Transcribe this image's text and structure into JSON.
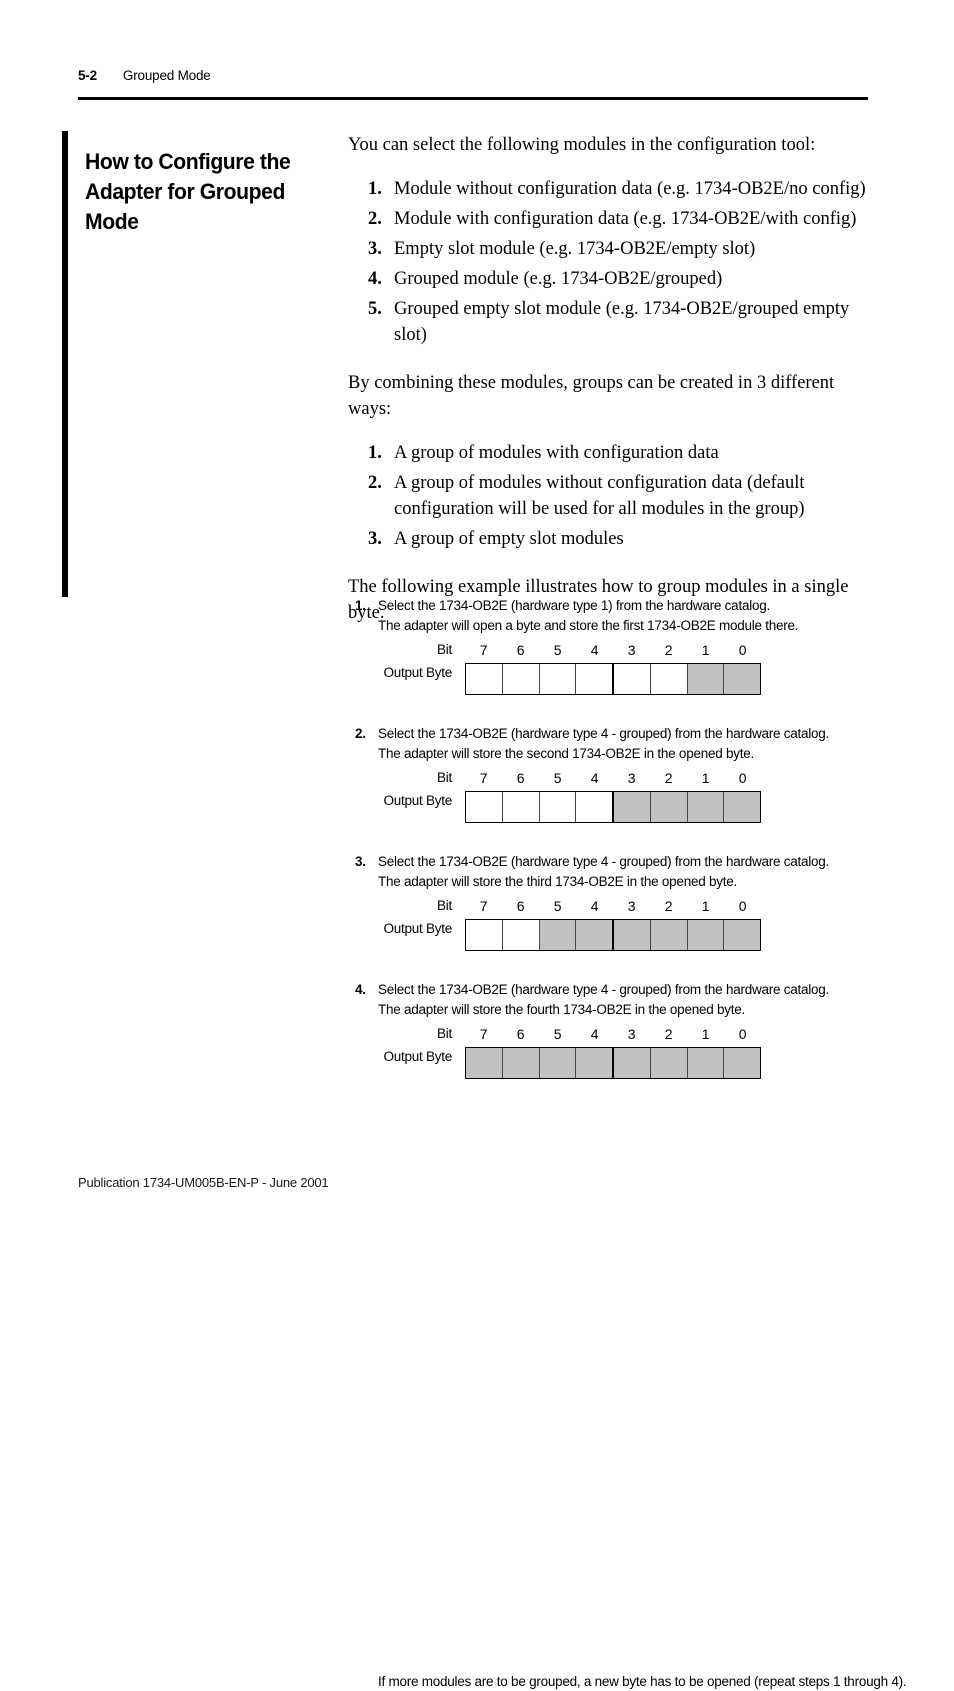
{
  "header": {
    "folio": "5-2",
    "chapter": "Grouped Mode"
  },
  "section": {
    "heading": "How to Configure the Adapter for Grouped Mode"
  },
  "body": {
    "intro": "You can select the following modules in the configuration tool:",
    "module_list": [
      {
        "marker": "1.",
        "text": "Module without configuration data (e.g. 1734-OB2E/no config)"
      },
      {
        "marker": "2.",
        "text": "Module with configuration data (e.g. 1734-OB2E/with config)"
      },
      {
        "marker": "3.",
        "text": "Empty slot module (e.g. 1734-OB2E/empty slot)"
      },
      {
        "marker": "4.",
        "text": "Grouped module (e.g. 1734-OB2E/grouped)"
      },
      {
        "marker": "5.",
        "text": "Grouped empty slot module (e.g. 1734-OB2E/grouped empty slot)"
      }
    ],
    "combining_intro": "By combining these modules, groups can be created in 3 different ways:",
    "group_list": [
      {
        "marker": "1.",
        "text": "A group of modules with configuration data"
      },
      {
        "marker": "2.",
        "text": "A group of modules without configuration data (default configuration will be used for all modules in the group)"
      },
      {
        "marker": "3.",
        "text": "A group of empty slot modules"
      }
    ],
    "example_intro": "The following example illustrates how to group modules in a single byte."
  },
  "diagram": {
    "bit_label": "Bit",
    "byte_label": "Output Byte",
    "bit_numbers": [
      "7",
      "6",
      "5",
      "4",
      "3",
      "2",
      "1",
      "0"
    ],
    "fill_color": "#c2c2c2",
    "empty_color": "#ffffff",
    "steps": [
      {
        "number": "1.",
        "line1": "Select the 1734-OB2E (hardware type 1) from the hardware catalog.",
        "line2": "The adapter will open a byte and store the first 1734-OB2E module there.",
        "bits_filled": [
          false,
          false,
          false,
          false,
          false,
          false,
          true,
          true
        ]
      },
      {
        "number": "2.",
        "line1": "Select the 1734-OB2E (hardware type 4 - grouped) from the hardware catalog.",
        "line2": "The adapter will store the second 1734-OB2E in the opened byte.",
        "bits_filled": [
          false,
          false,
          false,
          false,
          true,
          true,
          true,
          true
        ]
      },
      {
        "number": "3.",
        "line1": "Select the 1734-OB2E (hardware type 4 - grouped) from the hardware catalog.",
        "line2": "The adapter will store the third 1734-OB2E in the opened byte.",
        "bits_filled": [
          false,
          false,
          true,
          true,
          true,
          true,
          true,
          true
        ]
      },
      {
        "number": "4.",
        "line1": "Select the 1734-OB2E (hardware type 4 - grouped) from the hardware catalog.",
        "line2": "The adapter will store the fourth 1734-OB2E in the opened byte.",
        "bits_filled": [
          true,
          true,
          true,
          true,
          true,
          true,
          true,
          true
        ]
      }
    ],
    "closing_note": "If more modules are to be grouped, a new byte has to be opened (repeat steps 1 through 4)."
  },
  "footer": {
    "publication": "Publication 1734-UM005B-EN-P - June 2001"
  }
}
